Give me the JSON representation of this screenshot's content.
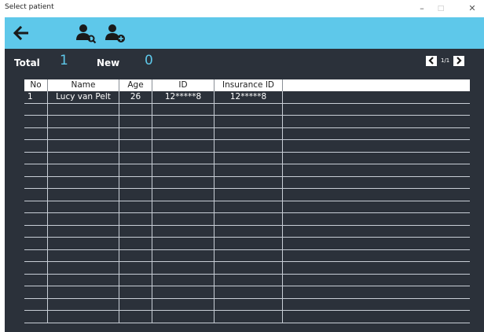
{
  "window": {
    "title": "Select patient",
    "controls": {
      "minimize": "–",
      "maximize": "□",
      "close": "✕"
    }
  },
  "toolbar": {
    "back_icon": "arrow-left-icon",
    "search_icon": "user-search-icon",
    "add_icon": "user-add-icon",
    "icon_color": "#1a1a1a",
    "background": "#5ec8ea"
  },
  "stats": {
    "total_label": "Total",
    "total_value": "1",
    "new_label": "New",
    "new_value": "0",
    "value_color": "#5ec8ea"
  },
  "pagination": {
    "page_info": "1/1"
  },
  "table": {
    "columns": [
      "No",
      "Name",
      "Age",
      "ID",
      "Insurance ID",
      ""
    ],
    "rows": [
      [
        "1",
        "Lucy van Pelt",
        "26",
        "12*****8",
        "12*****8",
        ""
      ]
    ],
    "empty_rows": 18
  }
}
